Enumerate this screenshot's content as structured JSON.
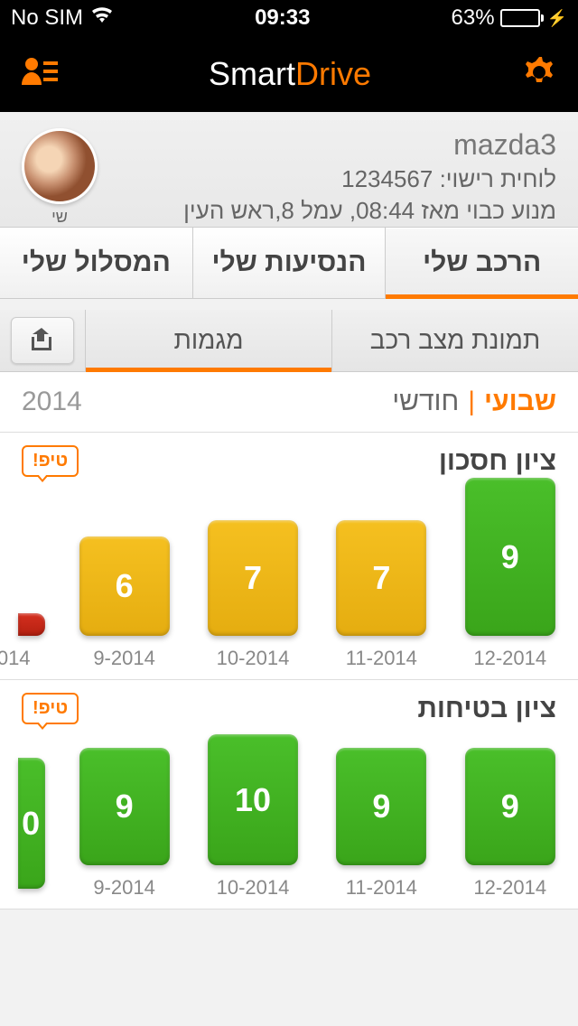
{
  "status": {
    "carrier": "No SIM",
    "time": "09:33",
    "battery_pct": "63%"
  },
  "header": {
    "title_a": "Smart",
    "title_b": "Drive"
  },
  "profile": {
    "name": "mazda3",
    "license": "לוחית רישוי: 1234567",
    "status": "מנוע כבוי מאז 08:44, עמל 8,ראש העין",
    "avatar_name": "שי"
  },
  "main_tabs": {
    "my_vehicle": "הרכב שלי",
    "my_trips": "הנסיעות שלי",
    "my_route": "המסלול שלי"
  },
  "sub_tabs": {
    "snapshot": "תמונת מצב רכב",
    "trends": "מגמות"
  },
  "period": {
    "weekly": "שבועי",
    "monthly": "חודשי",
    "year": "2014"
  },
  "tip_label": "טיפ!",
  "chart_data": [
    {
      "type": "bar",
      "title": "ציון חסכון",
      "xlabel": "",
      "ylabel": "",
      "ylim": [
        0,
        10
      ],
      "series": [
        {
          "category": "014",
          "value": null,
          "color": "red",
          "partial": true
        },
        {
          "category": "9-2014",
          "value": 6,
          "color": "yellow"
        },
        {
          "category": "10-2014",
          "value": 7,
          "color": "yellow"
        },
        {
          "category": "11-2014",
          "value": 7,
          "color": "yellow"
        },
        {
          "category": "12-2014",
          "value": 9,
          "color": "green"
        }
      ]
    },
    {
      "type": "bar",
      "title": "ציון בטיחות",
      "xlabel": "",
      "ylabel": "",
      "ylim": [
        0,
        10
      ],
      "series": [
        {
          "category": "",
          "value": 0,
          "color": "green",
          "partial": true
        },
        {
          "category": "9-2014",
          "value": 9,
          "color": "green"
        },
        {
          "category": "10-2014",
          "value": 10,
          "color": "green"
        },
        {
          "category": "11-2014",
          "value": 9,
          "color": "green"
        },
        {
          "category": "12-2014",
          "value": 9,
          "color": "green"
        }
      ]
    }
  ]
}
